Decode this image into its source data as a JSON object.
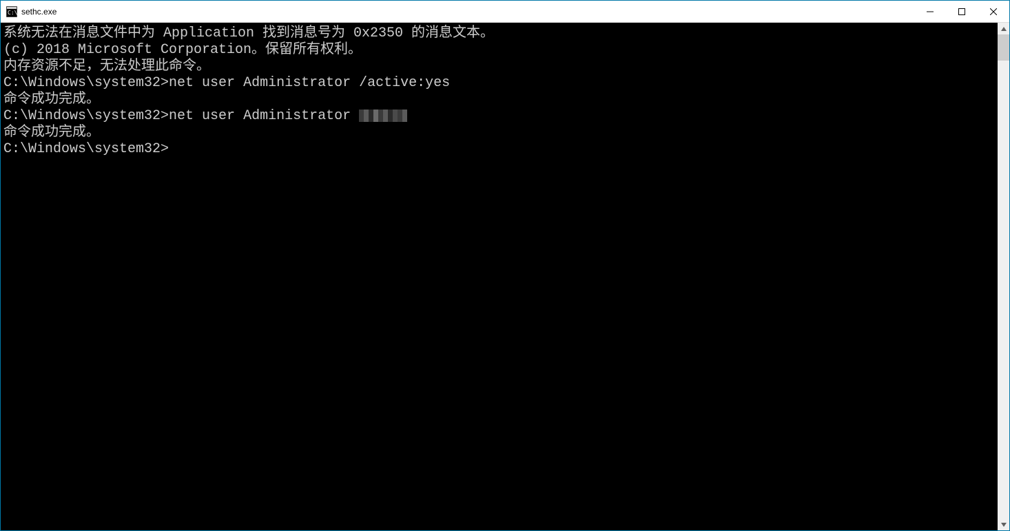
{
  "window": {
    "title": "sethc.exe"
  },
  "console": {
    "line1": "系统无法在消息文件中为 Application 找到消息号为 0x2350 的消息文本。",
    "blank1": "",
    "line2": "(c) 2018 Microsoft Corporation。保留所有权利。",
    "line3": "内存资源不足，无法处理此命令。",
    "blank2": "",
    "prompt1": "C:\\Windows\\system32>",
    "cmd1": "net user Administrator /active:yes",
    "result1": "命令成功完成。",
    "blank3": "",
    "blank4": "",
    "prompt2": "C:\\Windows\\system32>",
    "cmd2_prefix": "net user Administrator ",
    "result2": "命令成功完成。",
    "blank5": "",
    "blank6": "",
    "prompt3": "C:\\Windows\\system32>"
  }
}
